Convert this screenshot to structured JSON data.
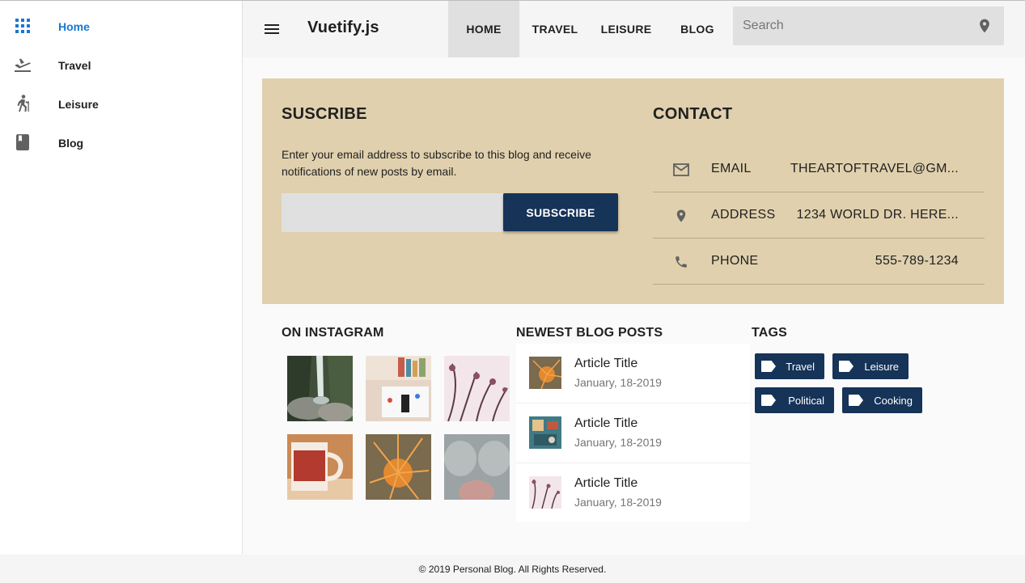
{
  "sidebar": {
    "items": [
      {
        "label": "Home",
        "icon": "apps-grid-icon",
        "active": true
      },
      {
        "label": "Travel",
        "icon": "flight-takeoff-icon"
      },
      {
        "label": "Leisure",
        "icon": "hiking-icon"
      },
      {
        "label": "Blog",
        "icon": "book-icon"
      }
    ]
  },
  "toolbar": {
    "brand": "Vuetify.js",
    "tabs": [
      {
        "label": "HOME",
        "active": true
      },
      {
        "label": "TRAVEL"
      },
      {
        "label": "LEISURE"
      },
      {
        "label": "BLOG"
      }
    ],
    "search": {
      "placeholder": "Search",
      "value": ""
    }
  },
  "subscribe": {
    "title": "SUSCRIBE",
    "description": "Enter your email address to subscribe to this blog and receive notifications of new posts by email.",
    "input_value": "",
    "button_label": "SUBSCRIBE"
  },
  "contact": {
    "title": "CONTACT",
    "rows": [
      {
        "label": "EMAIL",
        "value": "THEARTOFTRAVEL@GM...",
        "icon": "mail-icon"
      },
      {
        "label": "ADDRESS",
        "value": "1234 WORLD DR. HERE...",
        "icon": "location-pin-icon"
      },
      {
        "label": "PHONE",
        "value": "555-789-1234",
        "icon": "phone-icon"
      }
    ]
  },
  "instagram": {
    "title": "ON INSTAGRAM",
    "photos": [
      "waterfall-photo",
      "desk-photo",
      "pink-plant-photo",
      "mug-photo",
      "orange-spikes-photo",
      "cat-nose-photo"
    ]
  },
  "blog_posts": {
    "title": "NEWEST BLOG POSTS",
    "posts": [
      {
        "title": "Article Title",
        "date": "January, 18-2019"
      },
      {
        "title": "Article Title",
        "date": "January, 18-2019"
      },
      {
        "title": "Article Title",
        "date": "January, 18-2019"
      }
    ]
  },
  "tags": {
    "title": "TAGS",
    "items": [
      "Travel",
      "Leisure",
      "Political",
      "Cooking"
    ]
  },
  "footer": {
    "text": "© 2019 Personal Blog. All Rights Reserved."
  },
  "colors": {
    "accent": "#1976d2",
    "navy": "#163358",
    "beige": "#e0d0ad"
  }
}
